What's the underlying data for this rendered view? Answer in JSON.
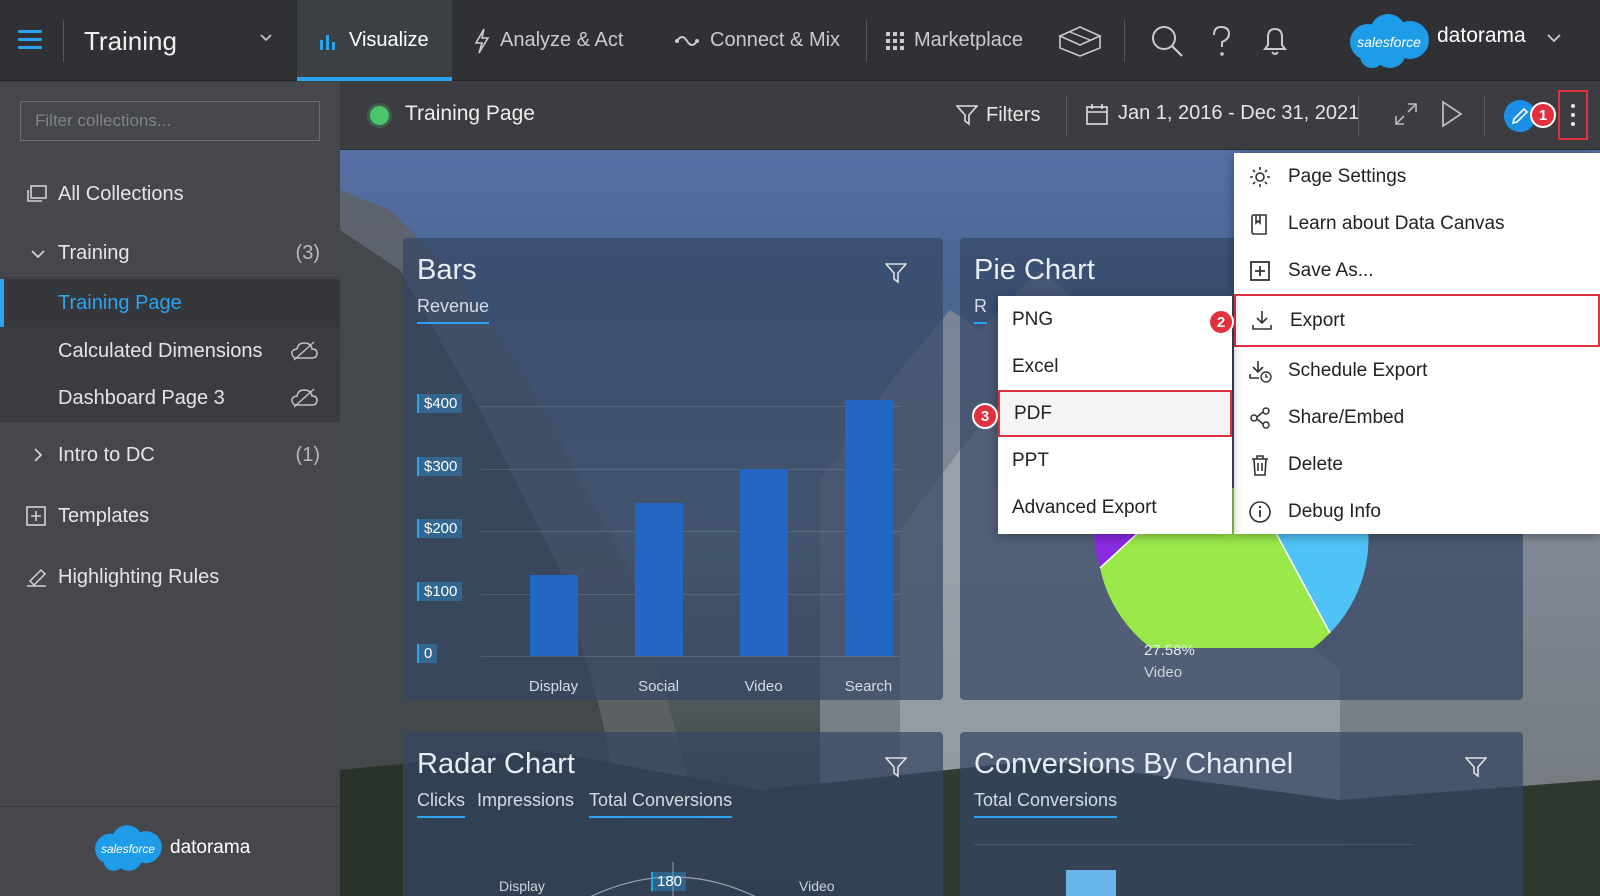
{
  "topbar": {
    "workspace": "Training",
    "nav": [
      {
        "label": "Visualize",
        "icon": "bar-chart-icon",
        "active": true
      },
      {
        "label": "Analyze & Act",
        "icon": "lightning-icon",
        "active": false
      },
      {
        "label": "Connect & Mix",
        "icon": "connect-icon",
        "active": false
      },
      {
        "label": "Marketplace",
        "icon": "grid-icon",
        "active": false
      }
    ],
    "brand_cloud": "salesforce",
    "brand_word": "datorama"
  },
  "sidebar": {
    "filter_placeholder": "Filter collections...",
    "all_collections": "All Collections",
    "training": {
      "label": "Training",
      "count": "(3)"
    },
    "pages": [
      "Training Page",
      "Calculated Dimensions",
      "Dashboard Page 3"
    ],
    "intro": {
      "label": "Intro to DC",
      "count": "(1)"
    },
    "templates": "Templates",
    "highlighting": "Highlighting Rules",
    "footer_cloud": "salesforce",
    "footer_word": "datorama"
  },
  "pagebar": {
    "title": "Training Page",
    "filters": "Filters",
    "date_range": "Jan 1, 2016 - Dec 31, 2021"
  },
  "steps": [
    "1",
    "2",
    "3"
  ],
  "widgets": {
    "bars": {
      "title": "Bars",
      "subtitle": "Revenue"
    },
    "pie": {
      "title": "Pie Chart",
      "subtitle": "R",
      "slice_pct": "27.58%",
      "slice_label": "Video",
      "colors": {
        "purple": "#8a2be2",
        "green": "#9be84a",
        "blue": "#4fc3f7"
      }
    },
    "radar": {
      "title": "Radar Chart",
      "tabs": [
        "Clicks",
        "Impressions",
        "Total Conversions"
      ],
      "labels": [
        "Display",
        "180",
        "Video"
      ]
    },
    "conversions": {
      "title": "Conversions By Channel",
      "subtitle": "Total Conversions"
    }
  },
  "chart_data": {
    "type": "bar",
    "categories": [
      "Display",
      "Social",
      "Video",
      "Search"
    ],
    "values": [
      130,
      245,
      300,
      410
    ],
    "yticks": [
      "$400",
      "$300",
      "$200",
      "$100",
      "0"
    ],
    "ylim": [
      0,
      400
    ],
    "color": "#2466c4"
  },
  "context_menu": [
    {
      "label": "Page Settings",
      "icon": "gear-icon"
    },
    {
      "label": "Learn about Data Canvas",
      "icon": "book-icon"
    },
    {
      "label": "Save As...",
      "icon": "plus-square-icon"
    },
    {
      "label": "Export",
      "icon": "download-icon"
    },
    {
      "label": "Schedule Export",
      "icon": "schedule-download-icon"
    },
    {
      "label": "Share/Embed",
      "icon": "share-icon"
    },
    {
      "label": "Delete",
      "icon": "trash-icon"
    },
    {
      "label": "Debug Info",
      "icon": "info-icon"
    }
  ],
  "export_menu": [
    "PNG",
    "Excel",
    "PDF",
    "PPT",
    "Advanced Export"
  ],
  "colors": {
    "accent": "#2aa3f0",
    "highlight": "#e1313f",
    "status": "#4cc56b"
  }
}
